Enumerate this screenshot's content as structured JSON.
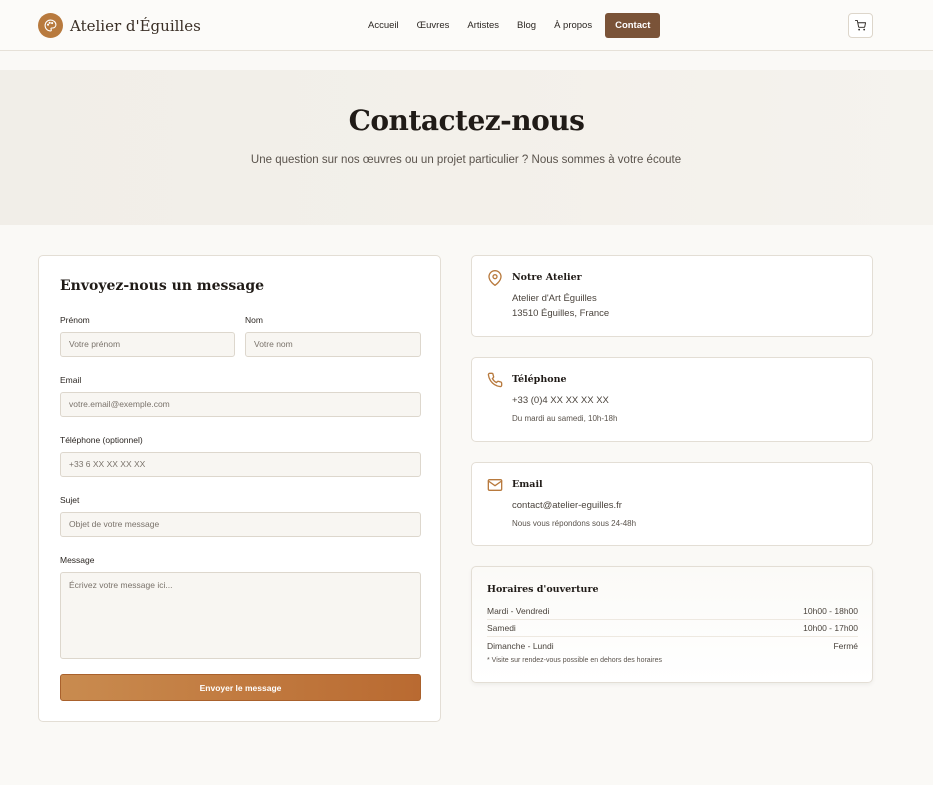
{
  "brand": {
    "name": "Atelier d'Éguilles"
  },
  "nav": {
    "items": [
      "Accueil",
      "Œuvres",
      "Artistes",
      "Blog",
      "À propos"
    ],
    "active": "Contact"
  },
  "icons": {
    "logo": "palette-icon",
    "cart": "cart-icon",
    "pin": "map-pin-icon",
    "phone": "phone-icon",
    "email": "mail-icon"
  },
  "colors": {
    "accent": "#b87a3e",
    "active_nav": "#7a5338",
    "button_start": "#c98b4f",
    "button_end": "#b96a31"
  },
  "hero": {
    "title": "Contactez-nous",
    "subtitle": "Une question sur nos œuvres ou un projet particulier ? Nous sommes à votre écoute"
  },
  "form": {
    "title": "Envoyez-nous un message",
    "firstname": {
      "label": "Prénom",
      "placeholder": "Votre prénom"
    },
    "lastname": {
      "label": "Nom",
      "placeholder": "Votre nom"
    },
    "email": {
      "label": "Email",
      "placeholder": "votre.email@exemple.com"
    },
    "phone": {
      "label": "Téléphone (optionnel)",
      "placeholder": "+33 6 XX XX XX XX"
    },
    "subject": {
      "label": "Sujet",
      "placeholder": "Objet de votre message"
    },
    "message": {
      "label": "Message",
      "placeholder": "Écrivez votre message ici..."
    },
    "submit": "Envoyer le message"
  },
  "info": {
    "atelier": {
      "title": "Notre Atelier",
      "line1": "Atelier d'Art Éguilles",
      "line2": "13510 Éguilles, France"
    },
    "phone": {
      "title": "Téléphone",
      "line1": "+33 (0)4 XX XX XX XX",
      "note": "Du mardi au samedi, 10h-18h"
    },
    "email": {
      "title": "Email",
      "line1": "contact@atelier-eguilles.fr",
      "note": "Nous vous répondons sous 24-48h"
    }
  },
  "hours": {
    "title": "Horaires d'ouverture",
    "rows": [
      {
        "day": "Mardi - Vendredi",
        "time": "10h00 - 18h00"
      },
      {
        "day": "Samedi",
        "time": "10h00 - 17h00"
      },
      {
        "day": "Dimanche - Lundi",
        "time": "Fermé"
      }
    ],
    "note": "* Visite sur rendez-vous possible en dehors des horaires"
  }
}
